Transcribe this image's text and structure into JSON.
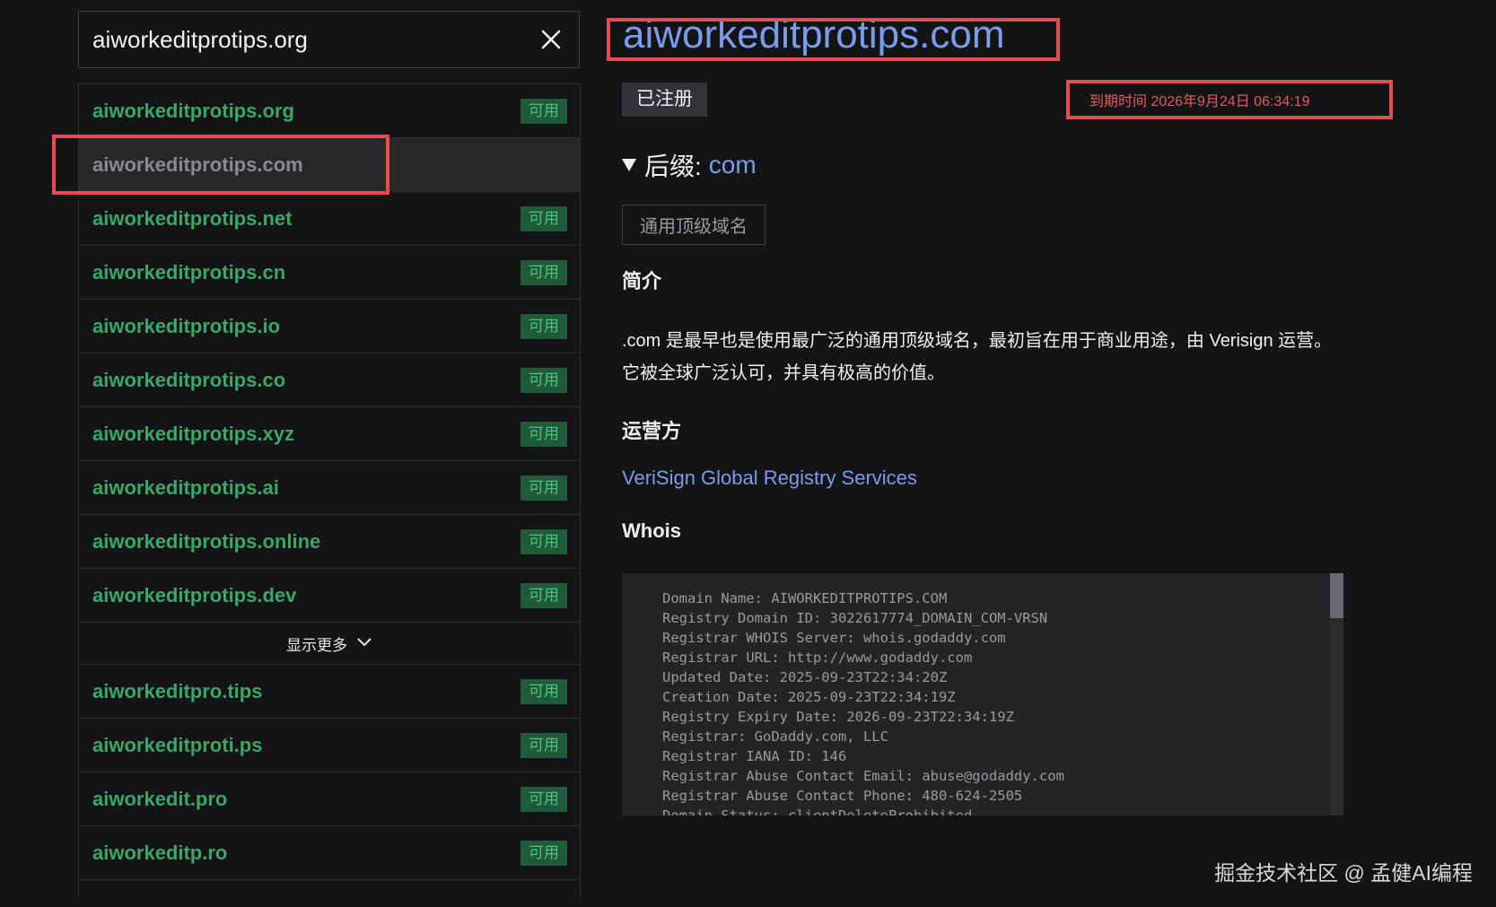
{
  "search": {
    "value": "aiworkeditprotips.org",
    "placeholder": ""
  },
  "domains_top": [
    {
      "name": "aiworkeditprotips.org",
      "badge": "可用",
      "available": true
    },
    {
      "name": "aiworkeditprotips.com",
      "badge": "",
      "available": false,
      "selected": true
    },
    {
      "name": "aiworkeditprotips.net",
      "badge": "可用",
      "available": true
    },
    {
      "name": "aiworkeditprotips.cn",
      "badge": "可用",
      "available": true
    },
    {
      "name": "aiworkeditprotips.io",
      "badge": "可用",
      "available": true
    },
    {
      "name": "aiworkeditprotips.co",
      "badge": "可用",
      "available": true
    },
    {
      "name": "aiworkeditprotips.xyz",
      "badge": "可用",
      "available": true
    },
    {
      "name": "aiworkeditprotips.ai",
      "badge": "可用",
      "available": true
    },
    {
      "name": "aiworkeditprotips.online",
      "badge": "可用",
      "available": true
    },
    {
      "name": "aiworkeditprotips.dev",
      "badge": "可用",
      "available": true
    }
  ],
  "show_more": {
    "label": "显示更多"
  },
  "domains_bottom": [
    {
      "name": "aiworkeditpro.tips",
      "badge": "可用",
      "available": true
    },
    {
      "name": "aiworkeditproti.ps",
      "badge": "可用",
      "available": true
    },
    {
      "name": "aiworkedit.pro",
      "badge": "可用",
      "available": true
    },
    {
      "name": "aiworkeditp.ro",
      "badge": "可用",
      "available": true
    }
  ],
  "detail": {
    "title": "aiworkeditprotips.com",
    "status": "已注册",
    "expiry": "到期时间 2026年9月24日 06:34:19",
    "suffix_label": "后缀:",
    "suffix_value": "com",
    "category": "通用顶级域名",
    "intro_heading": "简介",
    "intro_text": ".com 是最早也是使用最广泛的通用顶级域名，最初旨在用于商业用途，由 Verisign 运营。它被全球广泛认可，并具有极高的价值。",
    "operator_heading": "运营方",
    "operator_link": "VeriSign Global Registry Services",
    "whois_heading": "Whois",
    "whois_lines": [
      "Domain Name: AIWORKEDITPROTIPS.COM",
      "Registry Domain ID: 3022617774_DOMAIN_COM-VRSN",
      "Registrar WHOIS Server: whois.godaddy.com",
      "Registrar URL: http://www.godaddy.com",
      "Updated Date: 2025-09-23T22:34:20Z",
      "Creation Date: 2025-09-23T22:34:19Z",
      "Registry Expiry Date: 2026-09-23T22:34:19Z",
      "Registrar: GoDaddy.com, LLC",
      "Registrar IANA ID: 146",
      "Registrar Abuse Contact Email: abuse@godaddy.com",
      "Registrar Abuse Contact Phone: 480-624-2505",
      "Domain Status: clientDeleteProhibited"
    ]
  },
  "watermark": "掘金技术社区 @ 孟健AI编程",
  "colors": {
    "background": "#141417",
    "available_green": "#3aa667",
    "link_blue": "#7a9de9",
    "annotation_red": "#e44d52"
  }
}
